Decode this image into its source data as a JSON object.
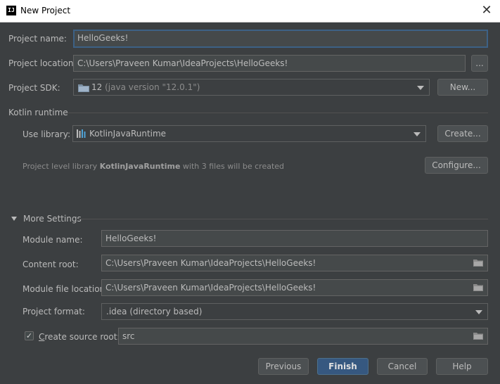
{
  "window": {
    "title": "New Project",
    "app_icon": "IJ"
  },
  "project_name": {
    "label": "Project name:",
    "value": "HelloGeeks!"
  },
  "project_location": {
    "label": "Project location:",
    "value": "C:\\Users\\Praveen Kumar\\IdeaProjects\\HelloGeeks!",
    "browse": "..."
  },
  "project_sdk": {
    "label": "Project SDK:",
    "version": "12",
    "detail": "(java version \"12.0.1\")",
    "new_button": "New..."
  },
  "kotlin": {
    "section": "Kotlin runtime",
    "use_library_label": "Use library:",
    "library": "KotlinJavaRuntime",
    "create_button": "Create...",
    "hint_prefix": "Project level library",
    "hint_name": "KotlinJavaRuntime",
    "hint_suffix": "with 3 files will be created",
    "configure_button": "Configure..."
  },
  "more_settings": {
    "section": "More Settings",
    "module_name_label": "Module name:",
    "module_name": "HelloGeeks!",
    "content_root_label": "Content root:",
    "content_root": "C:\\Users\\Praveen Kumar\\IdeaProjects\\HelloGeeks!",
    "module_file_label": "Module file location:",
    "module_file": "C:\\Users\\Praveen Kumar\\IdeaProjects\\HelloGeeks!",
    "project_format_label": "Project format:",
    "project_format": ".idea (directory based)",
    "source_root_label": "Create source root:",
    "source_root_checked": true,
    "source_root": "src"
  },
  "buttons": {
    "previous": "Previous",
    "finish": "Finish",
    "cancel": "Cancel",
    "help": "Help"
  },
  "colors": {
    "background": "#3c3f41",
    "primary_button": "#365880",
    "focus_border": "#3d6185"
  }
}
